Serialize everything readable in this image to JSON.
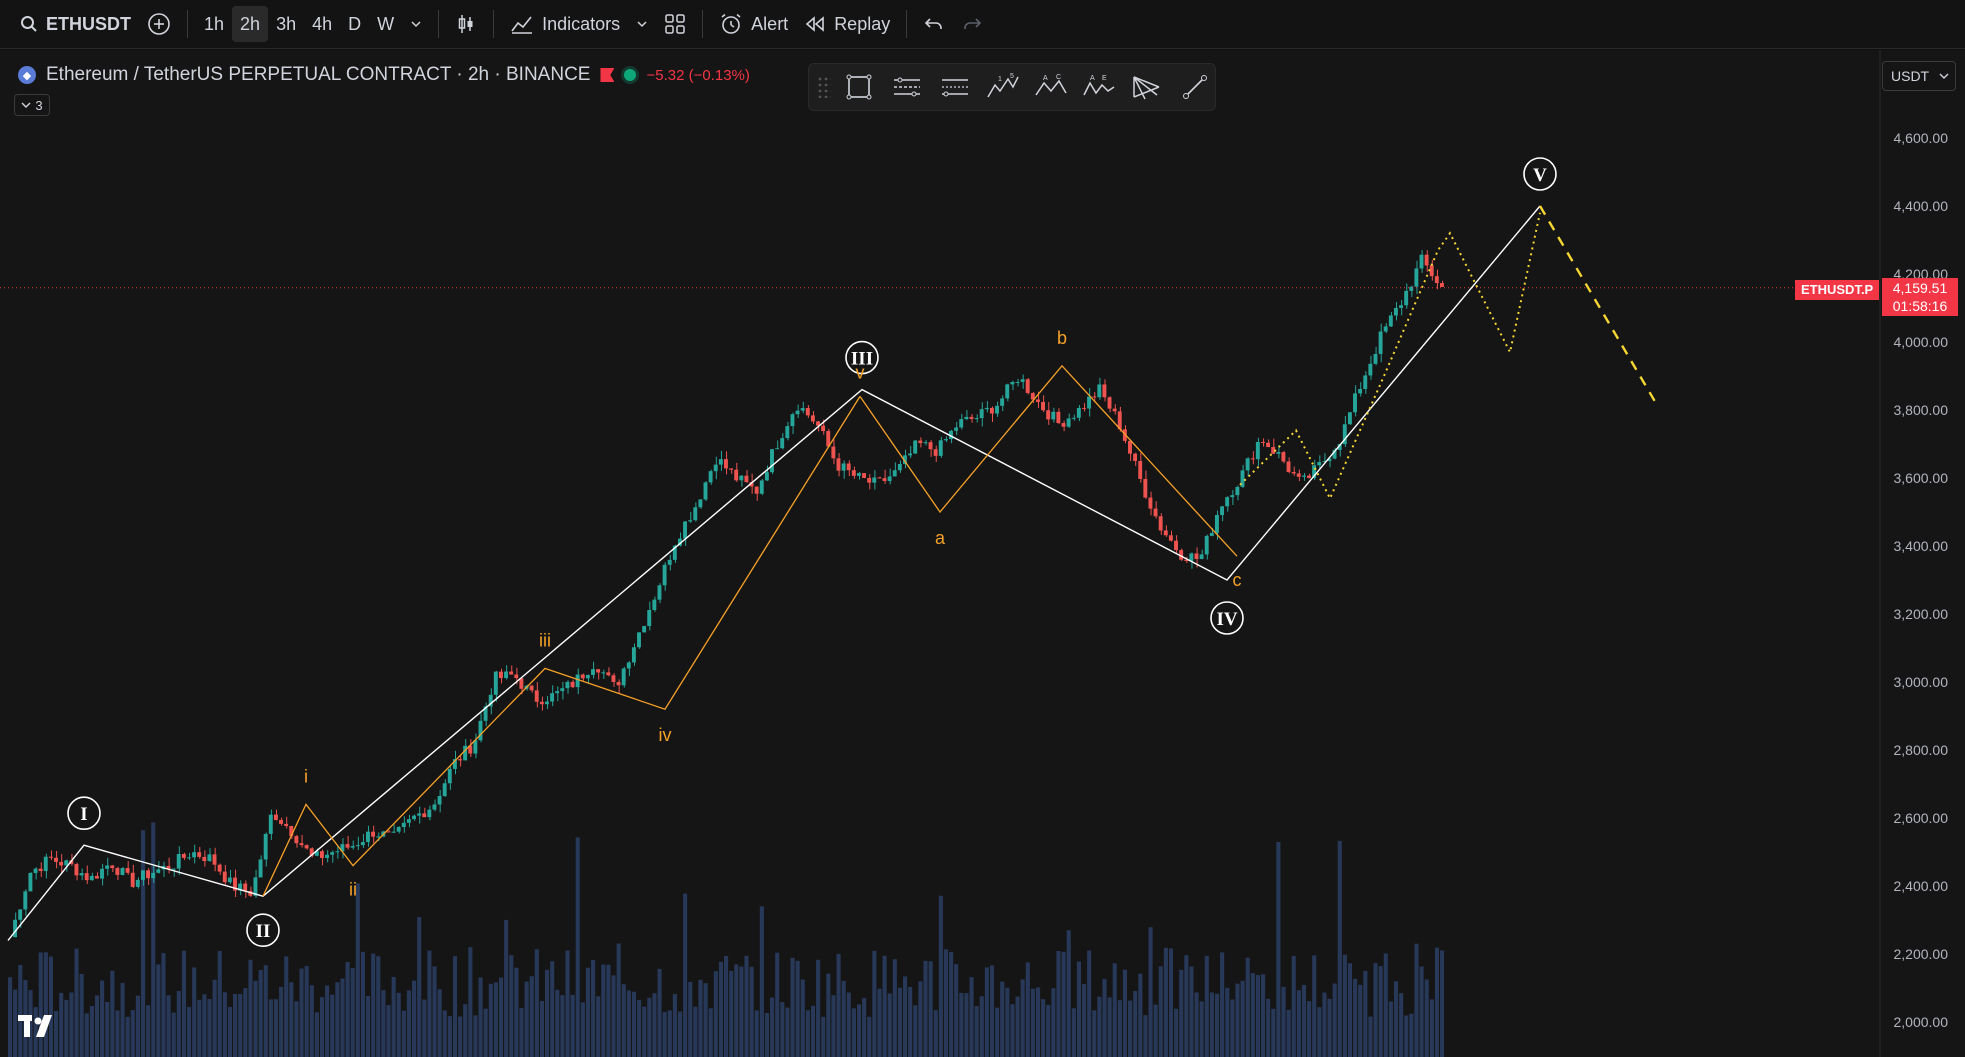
{
  "toolbar": {
    "symbol": "ETHUSDT",
    "intervals": [
      "1h",
      "2h",
      "3h",
      "4h",
      "D",
      "W"
    ],
    "active_interval": "2h",
    "indicators_label": "Indicators",
    "alert_label": "Alert",
    "replay_label": "Replay"
  },
  "header": {
    "title": "Ethereum / TetherUS PERPETUAL CONTRACT · 2h · BINANCE",
    "change": "−5.32 (−0.13%)",
    "collapse_count": "3"
  },
  "currency": "USDT",
  "price_axis": {
    "ticks": [
      "4,600.00",
      "4,400.00",
      "4,200.00",
      "4,000.00",
      "3,800.00",
      "3,600.00",
      "3,400.00",
      "3,200.00",
      "3,000.00",
      "2,800.00",
      "2,600.00",
      "2,400.00",
      "2,200.00",
      "2,000.00"
    ],
    "current_symbol": "ETHUSDT.P",
    "current_price": "4,159.51",
    "countdown": "01:58:16"
  },
  "colors": {
    "up": "#26a69a",
    "down": "#ef5350",
    "wave_primary": "#ffffff",
    "wave_secondary": "#f7a128",
    "projection": "#f5d633",
    "price_line": "#f23645"
  },
  "chart_data": {
    "type": "candlestick",
    "title": "Ethereum / TetherUS PERPETUAL CONTRACT · 2h · BINANCE",
    "ylim": [
      1950,
      4700
    ],
    "last_price": 4159.51,
    "close_path": [
      2250,
      2440,
      2480,
      2460,
      2420,
      2470,
      2410,
      2440,
      2460,
      2500,
      2480,
      2400,
      2380,
      2620,
      2560,
      2480,
      2500,
      2520,
      2560,
      2540,
      2600,
      2640,
      2760,
      2820,
      3010,
      3020,
      2950,
      2960,
      3000,
      3060,
      2980,
      3120,
      3260,
      3420,
      3520,
      3660,
      3600,
      3560,
      3700,
      3820,
      3760,
      3640,
      3600,
      3580,
      3620,
      3700,
      3680,
      3760,
      3780,
      3820,
      3900,
      3820,
      3760,
      3800,
      3860,
      3760,
      3600,
      3460,
      3380,
      3360,
      3520,
      3600,
      3720,
      3660,
      3580,
      3640,
      3720,
      3880,
      4020,
      4120,
      4240,
      4159.51
    ],
    "waves_primary": [
      {
        "label": "I",
        "price": 2520
      },
      {
        "label": "II",
        "price": 2370
      },
      {
        "label": "III",
        "price": 3860
      },
      {
        "label": "IV",
        "price": 3300
      },
      {
        "label": "V",
        "price": 4400
      }
    ],
    "waves_secondary": [
      {
        "label": "i",
        "price": 2640
      },
      {
        "label": "ii",
        "price": 2460
      },
      {
        "label": "iii",
        "price": 3040
      },
      {
        "label": "iv",
        "price": 2920
      },
      {
        "label": "v",
        "price": 3840
      },
      {
        "label": "a",
        "price": 3500
      },
      {
        "label": "b",
        "price": 3930
      },
      {
        "label": "c",
        "price": 3370
      }
    ],
    "projection_zigzag": [
      3580,
      3740,
      3540,
      3900,
      4270,
      4320,
      3970,
      4380
    ],
    "projection_target": 3810
  }
}
